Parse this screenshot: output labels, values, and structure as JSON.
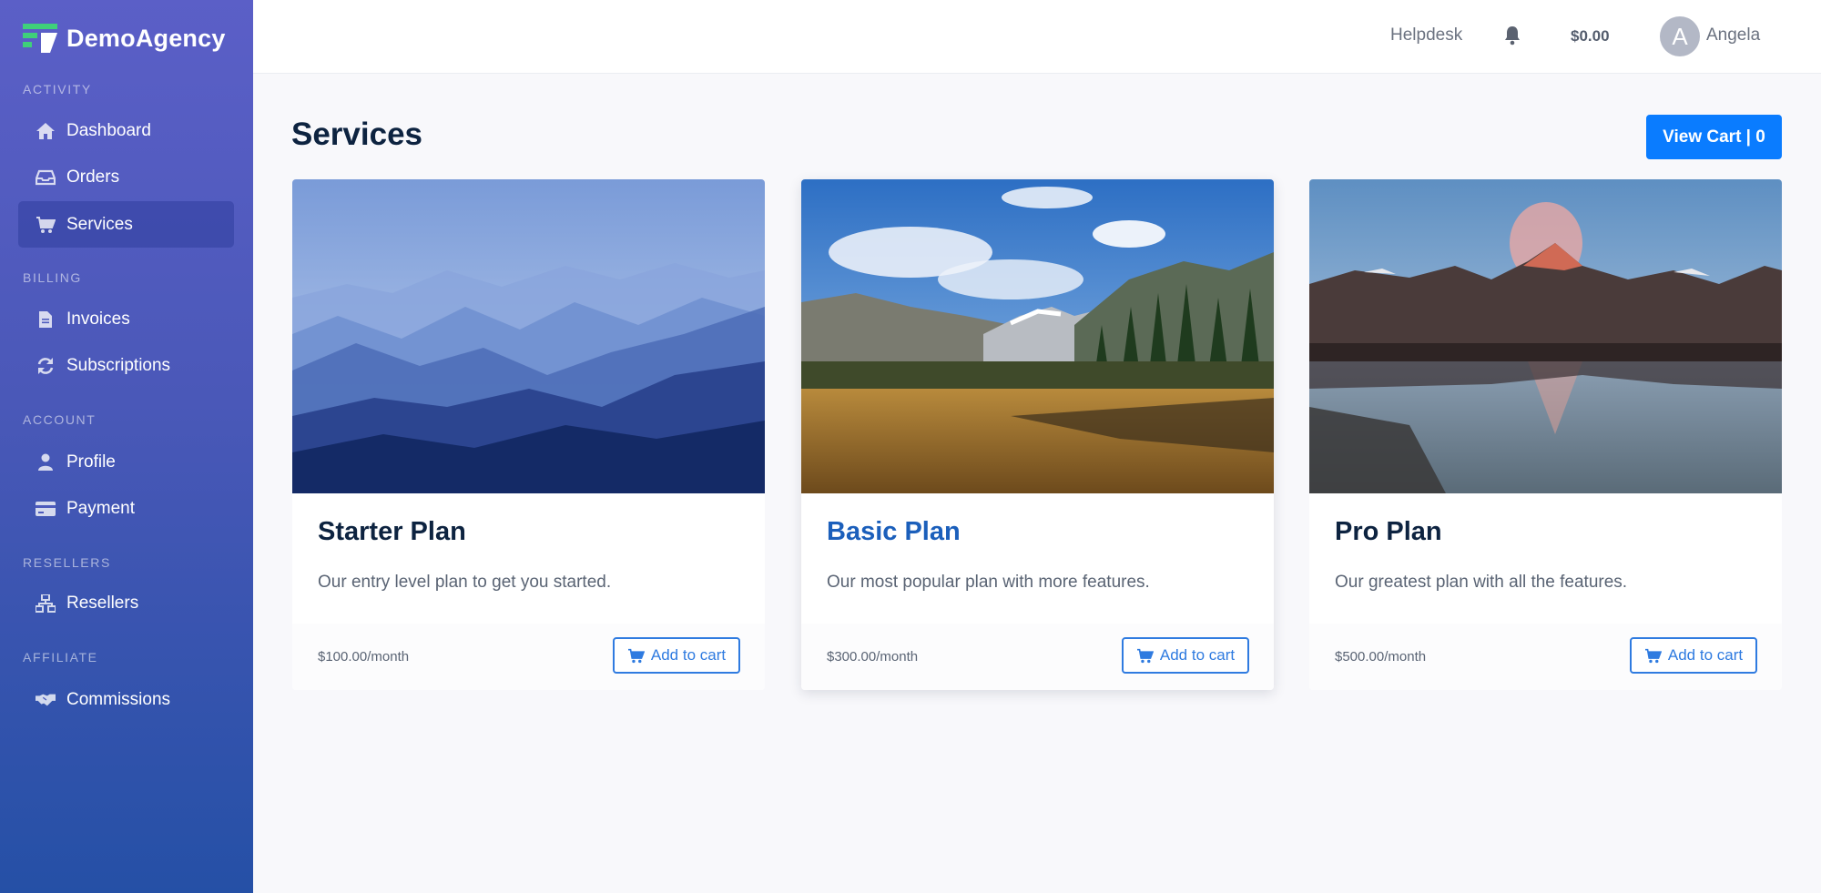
{
  "brand": {
    "name": "DemoAgency"
  },
  "sidebar": {
    "sections": [
      {
        "label": "ACTIVITY"
      },
      {
        "label": "BILLING"
      },
      {
        "label": "ACCOUNT"
      },
      {
        "label": "RESELLERS"
      },
      {
        "label": "AFFILIATE"
      }
    ],
    "items": [
      {
        "label": "Dashboard",
        "icon": "home-icon"
      },
      {
        "label": "Orders",
        "icon": "inbox-icon"
      },
      {
        "label": "Services",
        "icon": "cart-icon",
        "active": true
      },
      {
        "label": "Invoices",
        "icon": "file-icon"
      },
      {
        "label": "Subscriptions",
        "icon": "refresh-icon"
      },
      {
        "label": "Profile",
        "icon": "user-icon"
      },
      {
        "label": "Payment",
        "icon": "credit-card-icon"
      },
      {
        "label": "Resellers",
        "icon": "sitemap-icon"
      },
      {
        "label": "Commissions",
        "icon": "handshake-icon"
      }
    ]
  },
  "topbar": {
    "helpdesk": "Helpdesk",
    "balance": "$0.00",
    "avatar_initial": "A",
    "username": "Angela"
  },
  "main": {
    "title": "Services",
    "cart_button": "View Cart | 0",
    "cards": [
      {
        "title": "Starter Plan",
        "description": "Our entry level plan to get you started.",
        "price": "$100.00/month",
        "button": "Add to cart",
        "image": "misty-blue-mountains"
      },
      {
        "title": "Basic Plan",
        "description": "Our most popular plan with more features.",
        "price": "$300.00/month",
        "button": "Add to cart",
        "image": "meadow-mountains-sky"
      },
      {
        "title": "Pro Plan",
        "description": "Our greatest plan with all the features.",
        "price": "$500.00/month",
        "button": "Add to cart",
        "image": "mountain-lake-reflection"
      }
    ]
  },
  "colors": {
    "primary": "#0a7cff",
    "sidebar_top": "#5b5fc7",
    "sidebar_bottom": "#2550a6",
    "accent_link": "#2f7be0"
  }
}
